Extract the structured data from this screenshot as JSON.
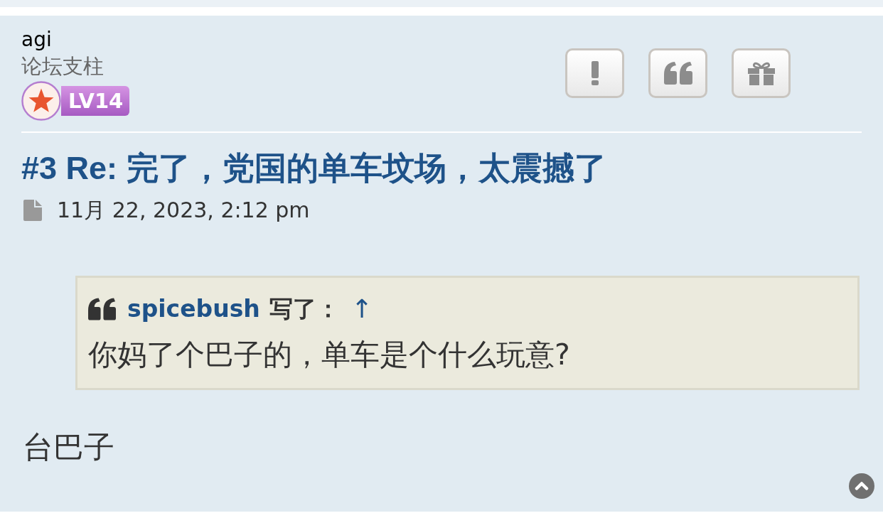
{
  "post": {
    "author": {
      "name": "agi",
      "rank_title": "论坛支柱",
      "level_badge": "LV14"
    },
    "title": "#3 Re: 完了，党国的单车坟场，太震撼了",
    "date": "11月 22, 2023, 2:12 pm",
    "quote": {
      "author": "spicebush",
      "wrote_label": "写了：",
      "jump_link": "↑",
      "text": "你妈了个巴子的，单车是个什么玩意?"
    },
    "body": "台巴子"
  }
}
